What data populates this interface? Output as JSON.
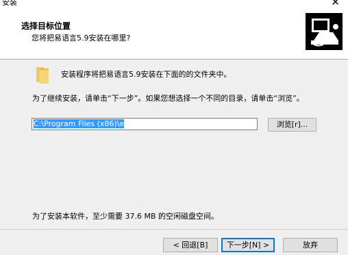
{
  "window": {
    "title": "安装",
    "close_glyph": "✕"
  },
  "header": {
    "title": "选择目标位置",
    "subtitle": "您将把易语言5.9安装在哪里?",
    "icon": "installer-computer-icon"
  },
  "content": {
    "folder_icon": "folder-icon",
    "folder_message": "安装程序将把易语言5.9安装在下面的的文件夹中。",
    "instruction": "为了继续安装，请单击“下一步”。如果您想选择一个不同的目录，请单击“浏览”。",
    "path_value": "C:\\Program Files (x86)\\e",
    "browse_label": "浏览[r]...",
    "space_required": "为了安装本软件，至少需要 37.6 MB 的空闲磁盘空间。"
  },
  "footer": {
    "back_label": "< 回退[B]",
    "next_label": "下一步[N] >",
    "cancel_label": "放弃"
  }
}
